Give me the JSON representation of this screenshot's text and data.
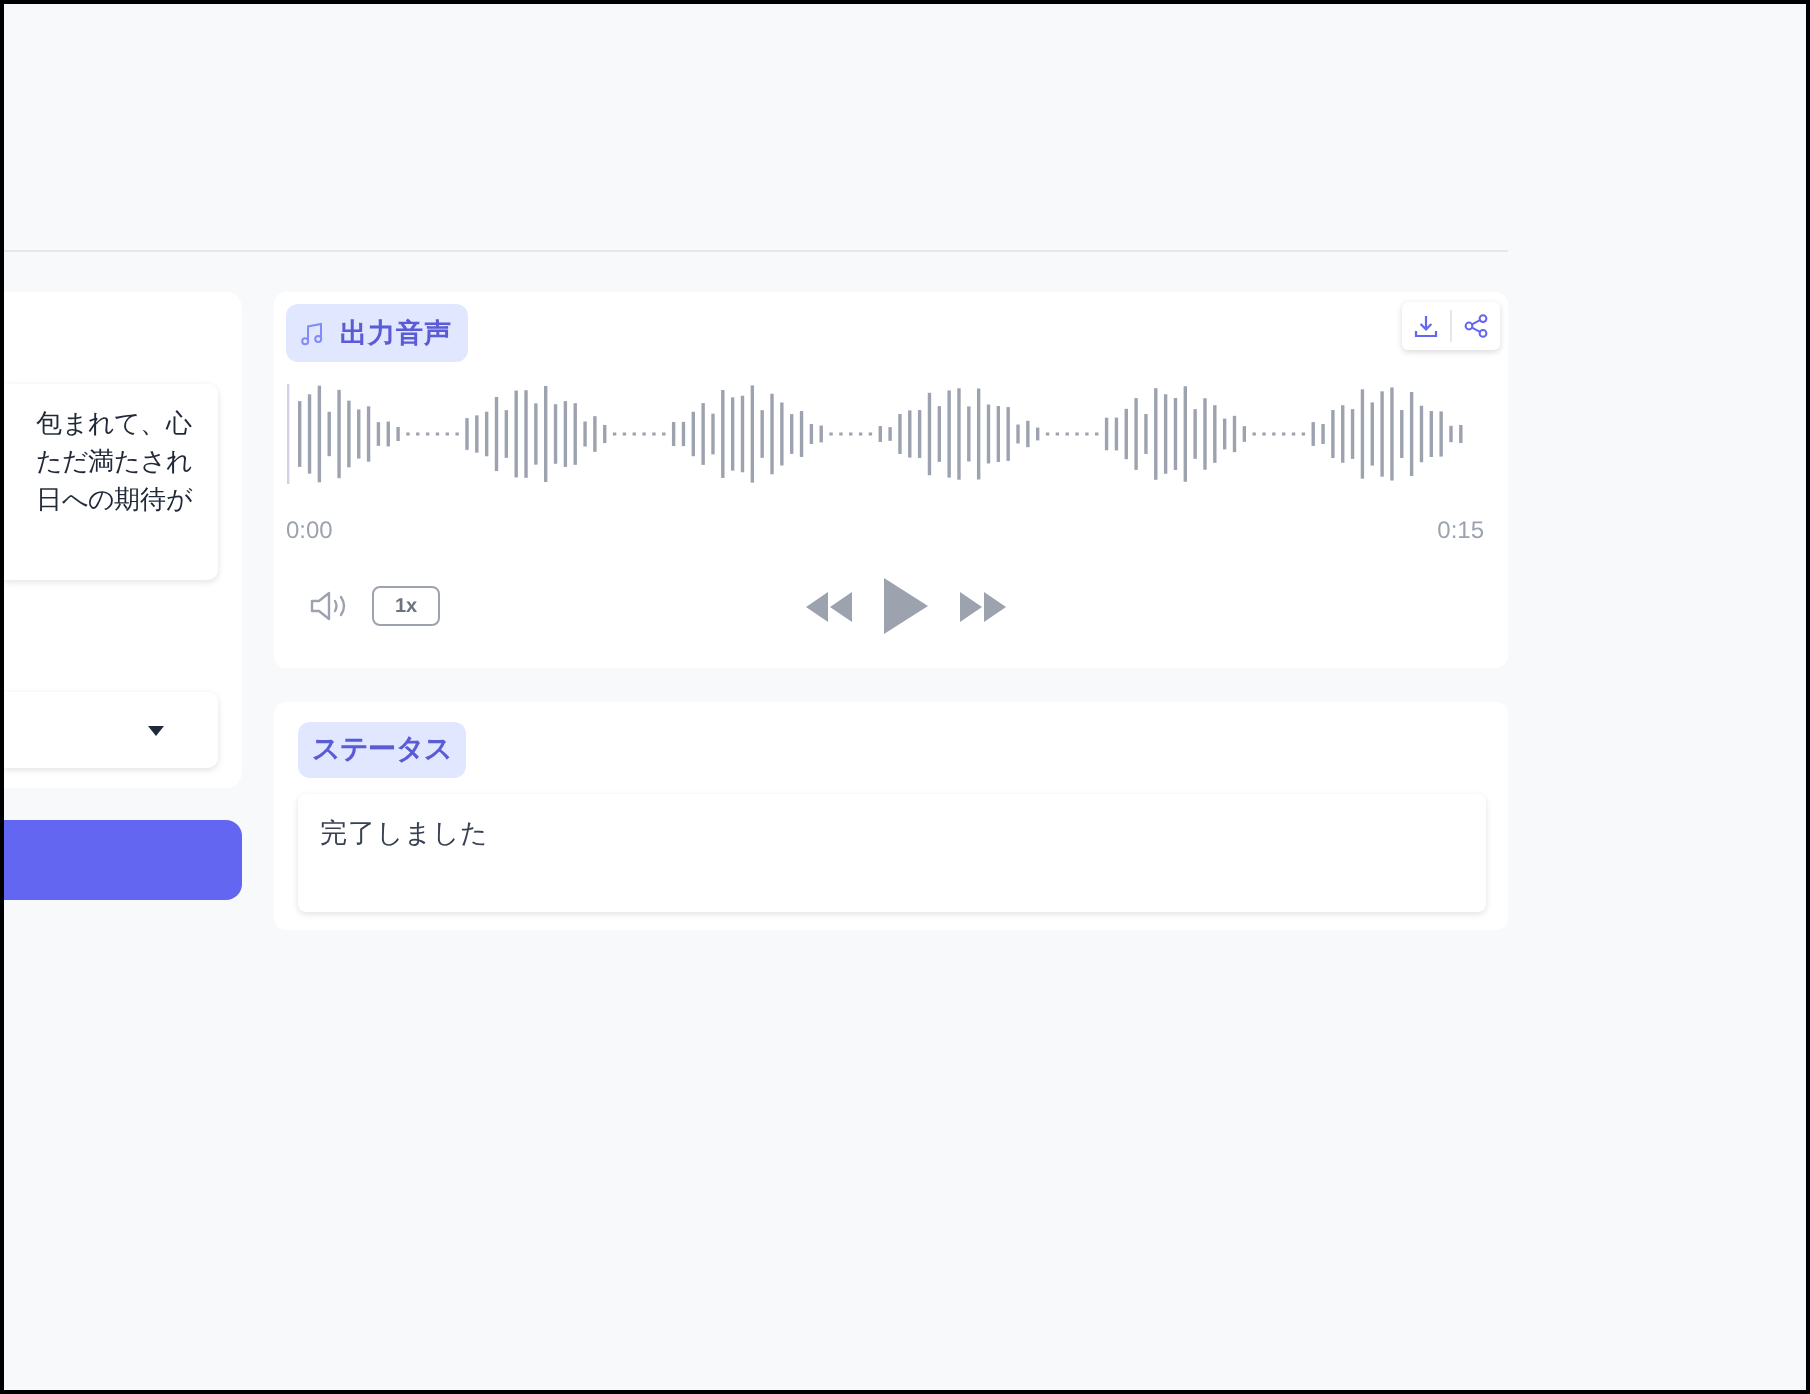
{
  "input_panel": {
    "text_field": {
      "lines": [
        "包まれて、心",
        "ただ満たされ",
        "日への期待が"
      ]
    }
  },
  "audio_player": {
    "title": "出力音声",
    "current_time": "0:00",
    "duration": "0:15",
    "speed": "1x",
    "playing": false
  },
  "status": {
    "title": "ステータス",
    "message": "完了しました"
  }
}
